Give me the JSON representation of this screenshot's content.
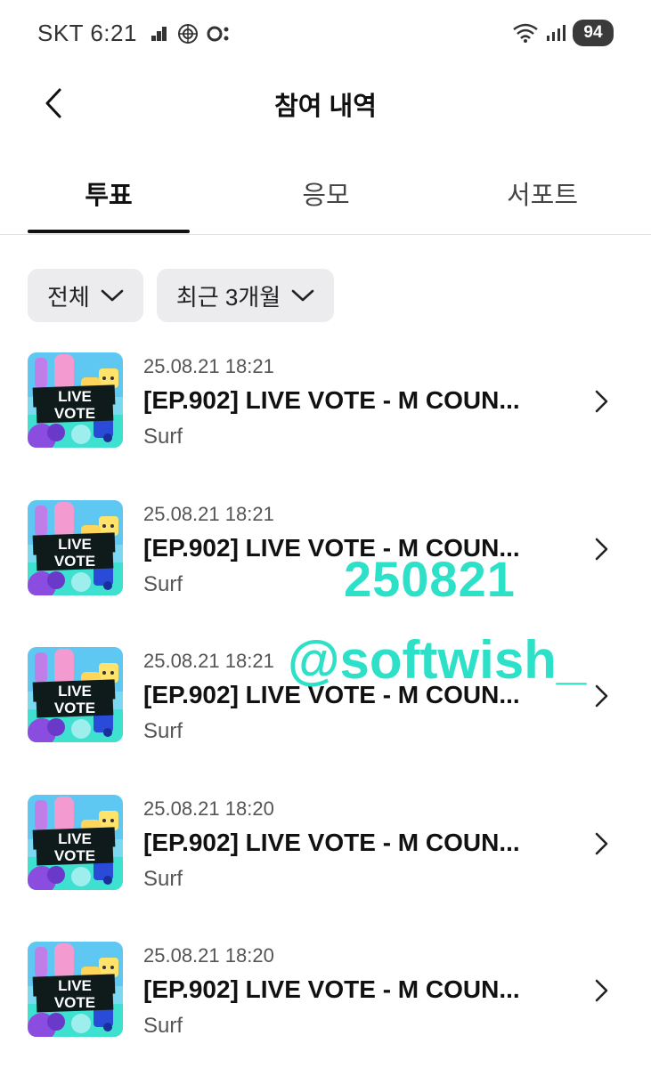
{
  "status_bar": {
    "carrier_time": "SKT 6:21",
    "battery": "94",
    "icons": [
      "signal-small-icon",
      "globe-icon",
      "record-icon",
      "wifi-icon",
      "cell-signal-icon"
    ]
  },
  "header": {
    "title": "참여 내역",
    "back_icon": "chevron-left-icon"
  },
  "tabs": [
    {
      "label": "투표",
      "active": true
    },
    {
      "label": "응모",
      "active": false
    },
    {
      "label": "서포트",
      "active": false
    }
  ],
  "filters": [
    {
      "label": "전체",
      "icon": "chevron-down-icon"
    },
    {
      "label": "최근 3개월",
      "icon": "chevron-down-icon"
    }
  ],
  "items": [
    {
      "date": "25.08.21 18:21",
      "title": "[EP.902] LIVE VOTE - M COUN...",
      "subtitle": "Surf",
      "thumb_text": [
        "LIVE",
        "VOTE"
      ]
    },
    {
      "date": "25.08.21 18:21",
      "title": "[EP.902] LIVE VOTE - M COUN...",
      "subtitle": "Surf",
      "thumb_text": [
        "LIVE",
        "VOTE"
      ]
    },
    {
      "date": "25.08.21 18:21",
      "title": "[EP.902] LIVE VOTE - M COUN...",
      "subtitle": "Surf",
      "thumb_text": [
        "LIVE",
        "VOTE"
      ]
    },
    {
      "date": "25.08.21 18:20",
      "title": "[EP.902] LIVE VOTE - M COUN...",
      "subtitle": "Surf",
      "thumb_text": [
        "LIVE",
        "VOTE"
      ]
    },
    {
      "date": "25.08.21 18:20",
      "title": "[EP.902] LIVE VOTE - M COUN...",
      "subtitle": "Surf",
      "thumb_text": [
        "LIVE",
        "VOTE"
      ]
    }
  ],
  "watermark": {
    "date": "250821",
    "handle": "@softwish_",
    "color": "#2de0c8"
  },
  "colors": {
    "text_primary": "#111111",
    "chip_bg": "#ececef",
    "thumb_teal": "#3ee0d0",
    "thumb_purple": "#8a4de0"
  }
}
